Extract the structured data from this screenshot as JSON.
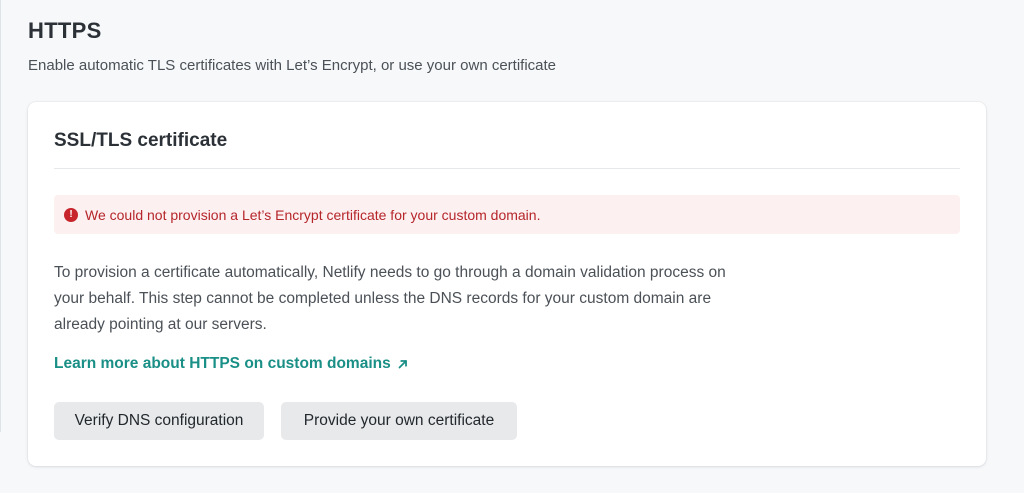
{
  "section": {
    "title": "HTTPS",
    "subtitle": "Enable automatic TLS certificates with Let’s Encrypt, or use your own certificate"
  },
  "card": {
    "title": "SSL/TLS certificate",
    "alert": {
      "icon": "exclamation-circle-icon",
      "text": "We could not provision a Let’s Encrypt certificate for your custom domain.",
      "color": "#b5262b",
      "background": "#fdf0f0"
    },
    "description": "To provision a certificate automatically, Netlify needs to go through a domain validation process on your behalf. This step cannot be completed unless the DNS records for your custom domain are already pointing at our servers.",
    "link": {
      "label": "Learn more about HTTPS on custom domains",
      "icon": "external-arrow-icon",
      "color": "#1a8f86"
    },
    "buttons": {
      "verify_label": "Verify DNS configuration",
      "provide_label": "Provide your own certificate"
    }
  }
}
